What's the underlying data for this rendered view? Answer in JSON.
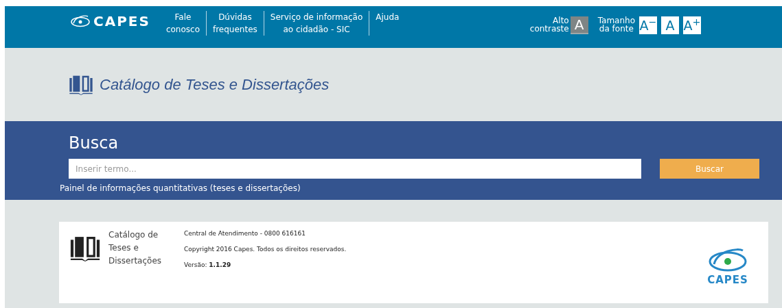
{
  "header": {
    "logo_text": "CAPES",
    "nav": [
      {
        "lines": [
          "Fale",
          "conosco"
        ]
      },
      {
        "lines": [
          "Dúvidas",
          "frequentes"
        ]
      },
      {
        "lines": [
          "Serviço de informação",
          "ao cidadão - SIC"
        ]
      },
      {
        "lines": [
          "Ajuda"
        ]
      }
    ],
    "contrast": {
      "lines": [
        "Alto",
        "contraste"
      ],
      "button": "A"
    },
    "font_size": {
      "lines": [
        "Tamanho",
        "da fonte"
      ],
      "buttons": [
        "A$^{−}$",
        "A",
        "A$^{+}$"
      ]
    }
  },
  "title": "Catálogo de Teses e Dissertações",
  "search": {
    "heading": "Busca",
    "placeholder": "Inserir termo...",
    "button": "Buscar",
    "link": "Painel de informações quantitativas (teses e dissertações)"
  },
  "footer": {
    "name_lines": [
      "Catálogo de",
      "Teses e",
      "Dissertações"
    ],
    "info": [
      "Central de Atendimento - 0800 616161",
      "Copyright 2016 Capes. Todos os direitos reservados."
    ],
    "version_label": "Versão:",
    "version": "1.1.29",
    "logo_text": "CAPES"
  }
}
